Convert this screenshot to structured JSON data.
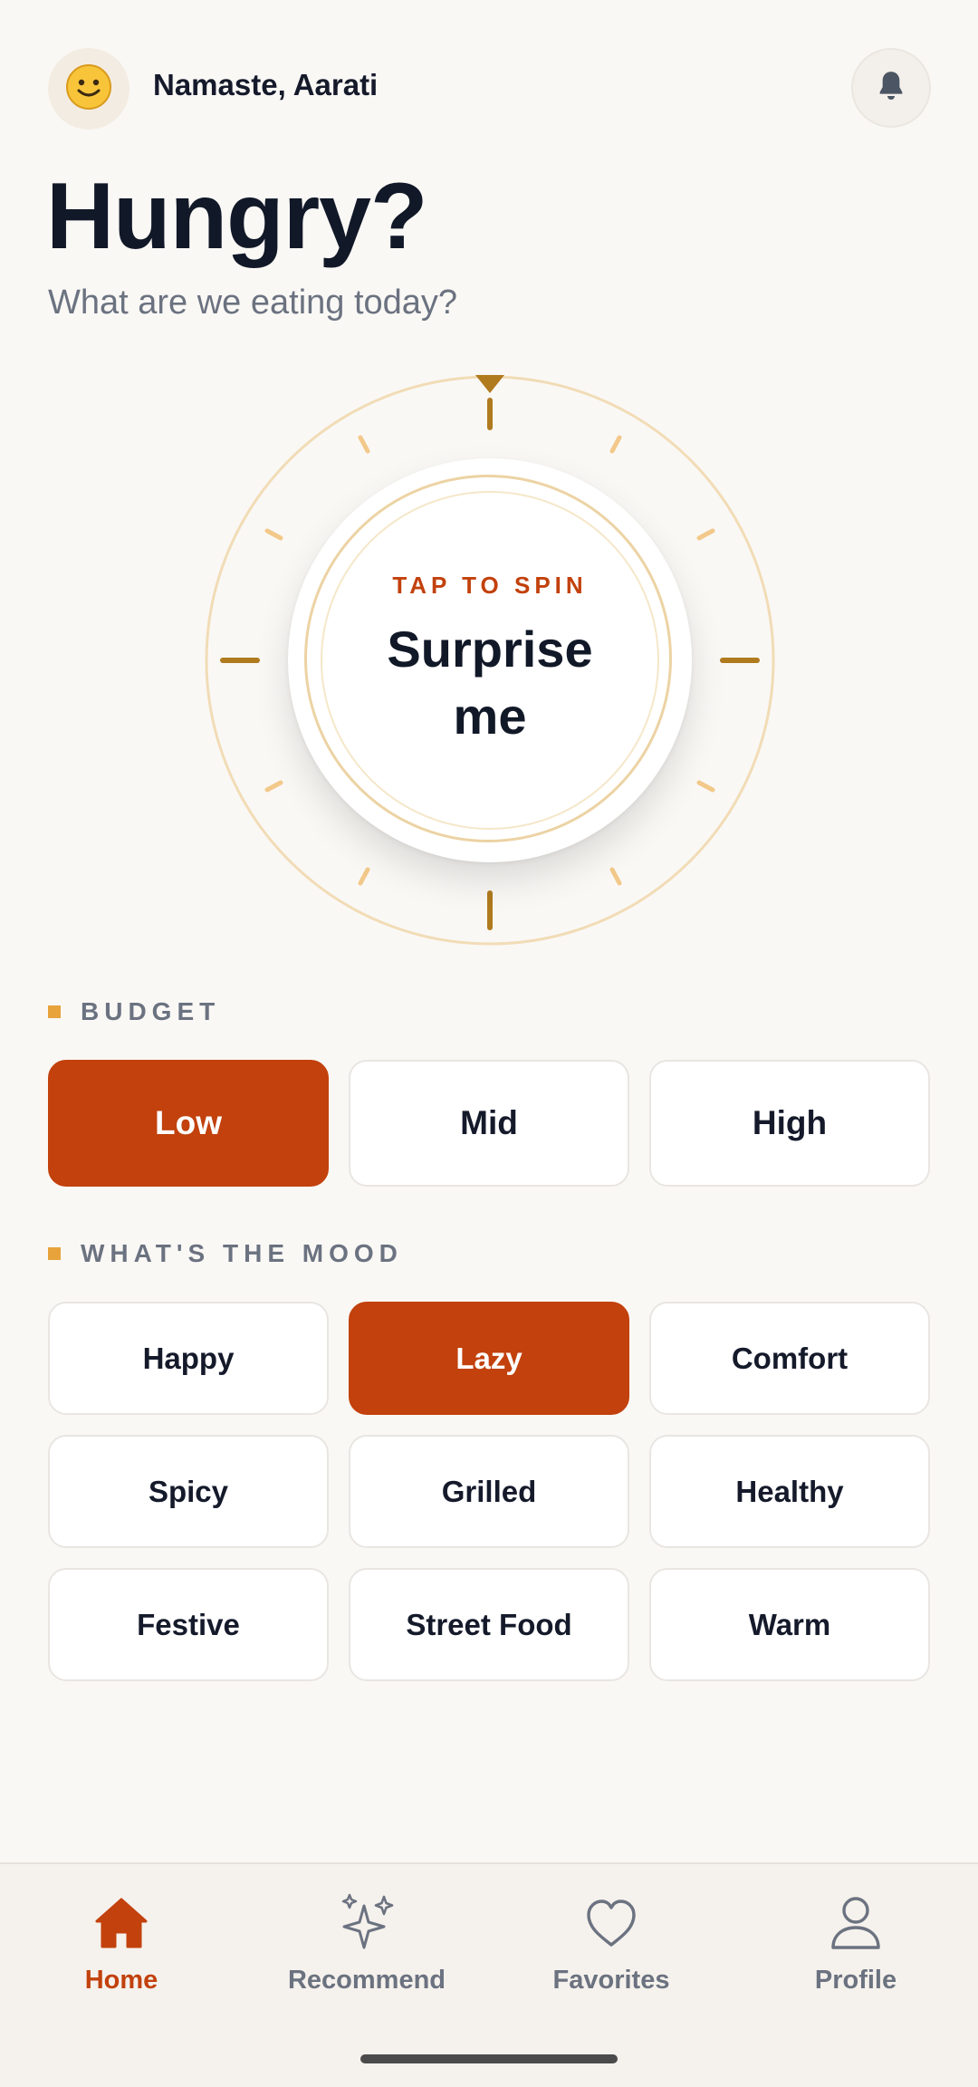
{
  "header": {
    "avatar_emoji": "🙂",
    "greeting": "Namaste, Aarati",
    "notification_icon": "bell-icon"
  },
  "hero": {
    "title": "Hungry?",
    "subtitle": "What are we eating today?"
  },
  "spinner": {
    "tap_label": "TAP TO SPIN",
    "button_label": "Surprise me"
  },
  "budget": {
    "label": "BUDGET",
    "options": [
      "Low",
      "Mid",
      "High"
    ],
    "selected": "Low"
  },
  "mood": {
    "label": "WHAT'S THE MOOD",
    "options": [
      "Happy",
      "Lazy",
      "Comfort",
      "Spicy",
      "Grilled",
      "Healthy",
      "Festive",
      "Street Food",
      "Warm"
    ],
    "selected": "Lazy"
  },
  "nav": {
    "items": [
      {
        "label": "Home",
        "icon": "home-icon",
        "active": true
      },
      {
        "label": "Recommend",
        "icon": "sparkles-icon",
        "active": false
      },
      {
        "label": "Favorites",
        "icon": "heart-icon",
        "active": false
      },
      {
        "label": "Profile",
        "icon": "user-icon",
        "active": false
      }
    ]
  },
  "colors": {
    "accent": "#c2410c",
    "gold": "#b07a1e",
    "background": "#faf8f5"
  }
}
